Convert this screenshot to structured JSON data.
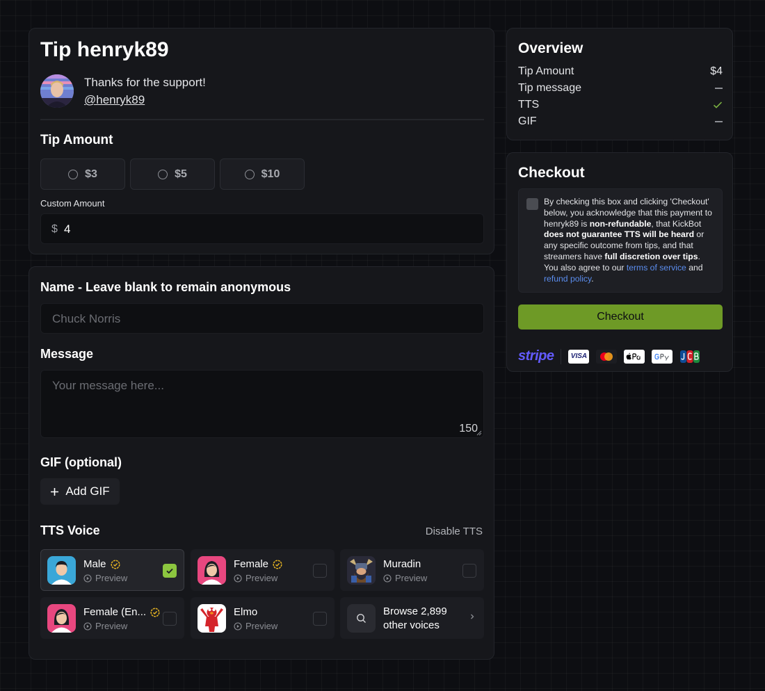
{
  "tip": {
    "title": "Tip henryk89",
    "support_text": "Thanks for the support!",
    "handle": "@henryk89",
    "amount_section_title": "Tip Amount",
    "amount_options": [
      "$3",
      "$5",
      "$10"
    ],
    "custom_amount_label": "Custom Amount",
    "currency_symbol": "$",
    "custom_amount_value": "4"
  },
  "form": {
    "name_label": "Name - Leave blank to remain anonymous",
    "name_placeholder": "Chuck Norris",
    "message_label": "Message",
    "message_placeholder": "Your message here...",
    "message_char_count": "150",
    "gif_label": "GIF (optional)",
    "add_gif_label": "Add GIF",
    "tts_label": "TTS Voice",
    "disable_tts_label": "Disable TTS",
    "voices": [
      {
        "name": "Male",
        "verified": true,
        "preview": "Preview",
        "selected": true
      },
      {
        "name": "Female",
        "verified": true,
        "preview": "Preview",
        "selected": false
      },
      {
        "name": "Muradin",
        "verified": false,
        "preview": "Preview",
        "selected": false
      },
      {
        "name": "Female (En...",
        "verified": true,
        "preview": "Preview",
        "selected": false
      },
      {
        "name": "Elmo",
        "verified": false,
        "preview": "Preview",
        "selected": false
      }
    ],
    "browse_voices_line1": "Browse 2,899",
    "browse_voices_line2": "other voices"
  },
  "overview": {
    "title": "Overview",
    "rows": [
      {
        "label": "Tip Amount",
        "value": "$4"
      },
      {
        "label": "Tip message",
        "value": ""
      },
      {
        "label": "TTS",
        "value": ""
      },
      {
        "label": "GIF",
        "value": ""
      }
    ]
  },
  "checkout": {
    "title": "Checkout",
    "terms": {
      "t1": "By checking this box and clicking 'Checkout' below, you acknowledge that this payment to henryk89 is ",
      "b1": "non-refundable",
      "t2": ", that KickBot ",
      "b2": "does not guarantee TTS will be heard",
      "t3": " or any specific outcome from tips, and that streamers have ",
      "b3": "full discretion over tips",
      "t4": ". You also agree to our ",
      "link1": "terms of service",
      "t5": " and ",
      "link2": "refund policy",
      "t6": "."
    },
    "button_label": "Checkout",
    "stripe_label": "stripe",
    "visa_label": "VISA"
  },
  "colors": {
    "accent_green": "#6e9a26",
    "check_green": "#8cc63f",
    "verified_gold": "#e6b422",
    "link_blue": "#5b8dee"
  }
}
